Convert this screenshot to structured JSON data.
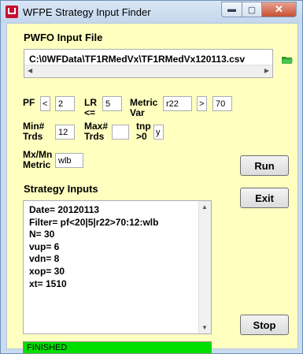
{
  "window": {
    "title": "WFPE Strategy Input Finder"
  },
  "input_file": {
    "heading": "PWFO Input File",
    "path": "C:\\0WFData\\TF1RMedVx\\TF1RMedVx120113.csv"
  },
  "params": {
    "pf_label": "PF",
    "pf_op": "<",
    "pf_value": "2",
    "lr_label": "LR",
    "lr_sub": "<=",
    "lr_value": "5",
    "metric_var_label": "Metric",
    "metric_var_sub": "Var",
    "metric_var_value": "r22",
    "metric_op": ">",
    "metric_value": "70",
    "min_trds_label": "Min#",
    "min_trds_sub": "Trds",
    "min_trds_value": "12",
    "max_trds_label": "Max#",
    "max_trds_sub": "Trds",
    "max_trds_value": "",
    "tnp_label": "tnp",
    "tnp_sub": ">0",
    "tnp_value": "y",
    "mxmn_label": "Mx/Mn",
    "mxmn_sub": "Metric",
    "mxmn_value": "wlb"
  },
  "strategy": {
    "heading": "Strategy Inputs",
    "lines": [
      "Date= 20120113",
      "Filter= pf<20|5|r22>70:12:wlb",
      "N=  30",
      "vup=  6",
      "vdn=  8",
      "xop=  30",
      "xt=  1510"
    ]
  },
  "buttons": {
    "run": "Run",
    "exit": "Exit",
    "stop": "Stop"
  },
  "status": {
    "text": "FINISHED",
    "color": "#00e000"
  },
  "icons": {
    "folder": "folder-open-icon",
    "app": "app-logo-icon"
  }
}
